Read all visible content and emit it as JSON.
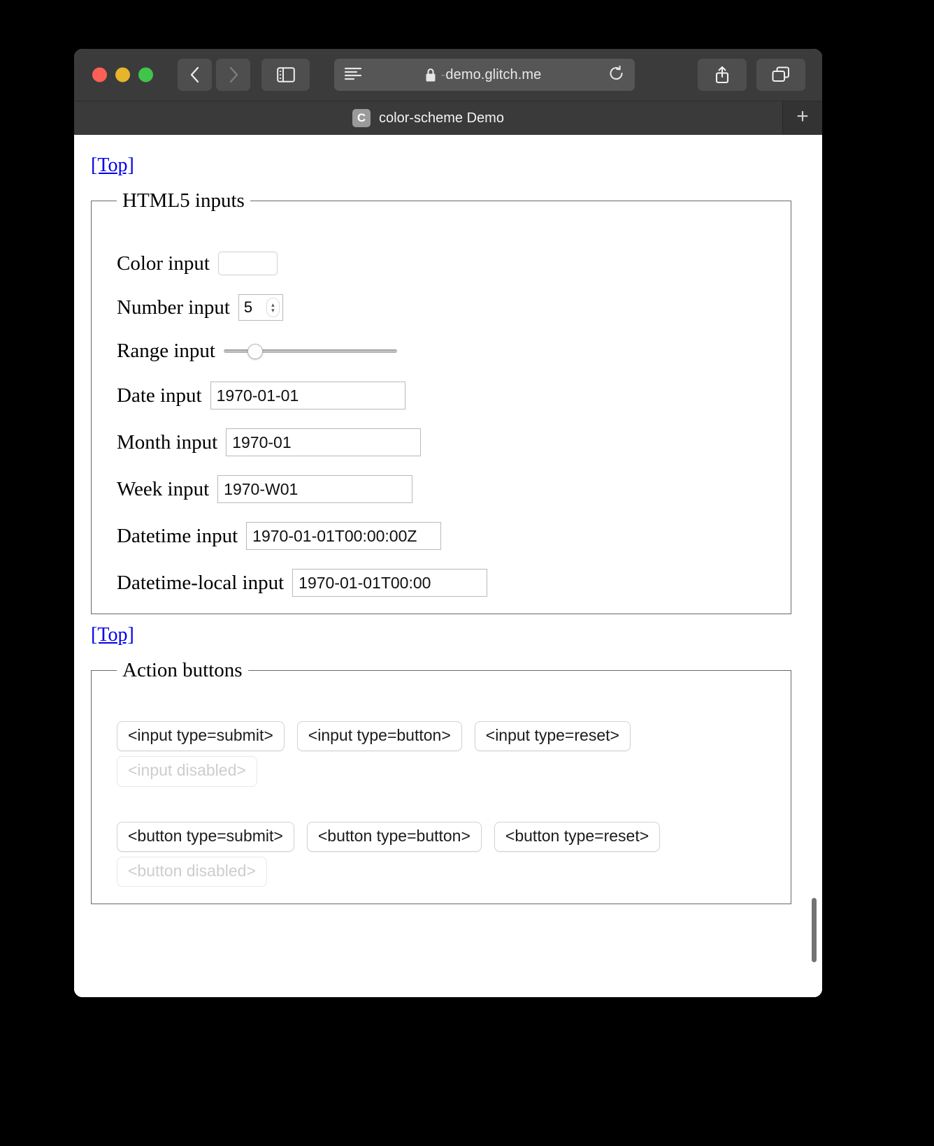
{
  "window": {
    "traffic_lights": [
      "close",
      "minimize",
      "maximize"
    ],
    "colors": {
      "close": "#ff5f57",
      "minimize": "#e6b52c",
      "maximize": "#3fc54a",
      "toolbar_bg": "#3b3b3b",
      "tabstrip_bg": "#333333",
      "link": "#0000ee",
      "swatch": "#000000"
    }
  },
  "toolbar": {
    "back_icon": "chevron-left-icon",
    "forward_icon": "chevron-right-icon",
    "sidebar_icon": "sidebar-toggle-icon",
    "reader_icon": "reader-view-icon",
    "lock_icon": "lock-icon",
    "url_prefix": "-",
    "url": "demo.glitch.me",
    "url_full": "demo.glitch.me",
    "reload_icon": "reload-icon",
    "share_icon": "share-icon",
    "tab_overview_icon": "tab-overview-icon"
  },
  "tabstrip": {
    "favicon_letter": "C",
    "title": "color-scheme Demo",
    "new_tab_label": "+"
  },
  "page": {
    "top_link_1": "[Top]",
    "top_link_2": "[Top]",
    "sections": [
      {
        "legend": "HTML5 inputs",
        "fields": [
          {
            "label": "Color input",
            "type": "color",
            "value": "#000000"
          },
          {
            "label": "Number input",
            "type": "number",
            "value": "5"
          },
          {
            "label": "Range input",
            "type": "range",
            "value": "15",
            "min": "0",
            "max": "100"
          },
          {
            "label": "Date input",
            "type": "date",
            "value": "1970-01-01"
          },
          {
            "label": "Month input",
            "type": "month",
            "value": "1970-01"
          },
          {
            "label": "Week input",
            "type": "week",
            "value": "1970-W01"
          },
          {
            "label": "Datetime input",
            "type": "datetime",
            "value": "1970-01-01T00:00:00Z"
          },
          {
            "label": "Datetime-local input",
            "type": "datetime-local",
            "value": "1970-01-01T00:00"
          }
        ]
      },
      {
        "legend": "Action buttons",
        "rows": [
          [
            "<input type=submit>",
            "<input type=button>",
            "<input type=reset>"
          ],
          [
            "<input disabled>"
          ],
          [
            "<button type=submit>",
            "<button type=button>",
            "<button type=reset>"
          ],
          [
            "<button disabled>"
          ]
        ]
      }
    ]
  },
  "scrollbar": {
    "position_percent": 82
  }
}
